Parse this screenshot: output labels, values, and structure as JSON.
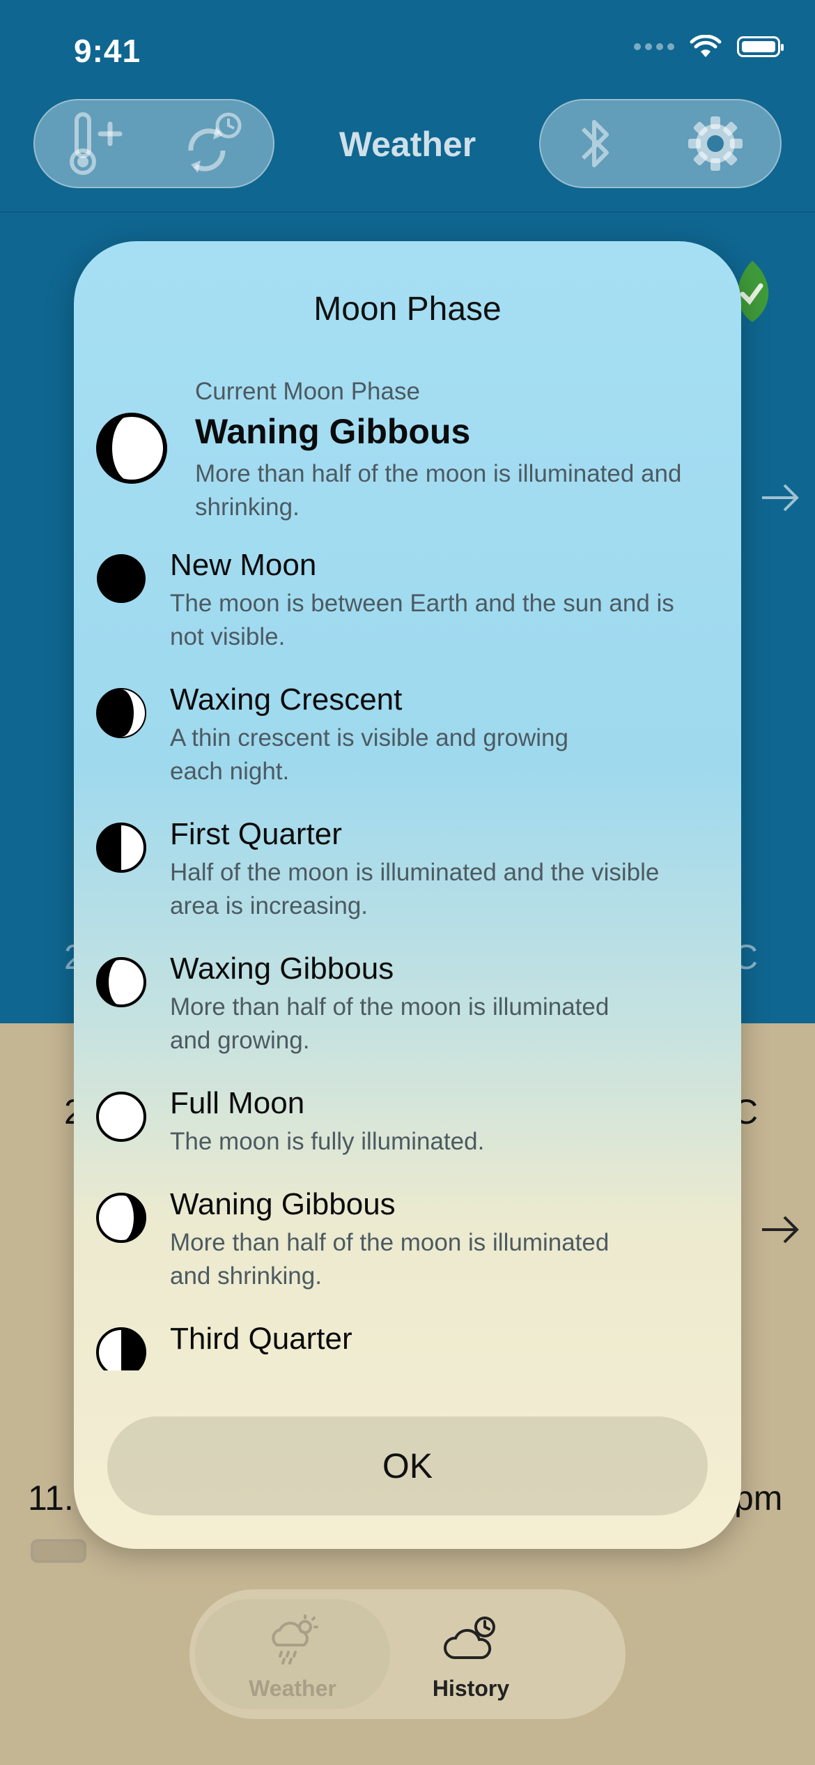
{
  "status_bar": {
    "time": "9:41"
  },
  "nav": {
    "title": "Weather"
  },
  "modal": {
    "title": "Moon Phase",
    "current": {
      "label": "Current Moon Phase",
      "name": "Waning Gibbous",
      "description": "More than half of the moon is illuminated and shrinking."
    },
    "phases": [
      {
        "name": "New Moon",
        "description": "The moon is between Earth and the sun and is not visible.",
        "icon": "new-moon-icon"
      },
      {
        "name": "Waxing Crescent",
        "description": "A thin crescent is visible and growing each night.",
        "icon": "waxing-crescent-icon"
      },
      {
        "name": "First Quarter",
        "description": "Half of the moon is illuminated and the visible area is increasing.",
        "icon": "first-quarter-icon"
      },
      {
        "name": "Waxing Gibbous",
        "description": "More than half of the moon is illuminated and growing.",
        "icon": "waxing-gibbous-icon"
      },
      {
        "name": "Full Moon",
        "description": "The moon is fully illuminated.",
        "icon": "full-moon-icon"
      },
      {
        "name": "Waning Gibbous",
        "description": "More than half of the moon is illuminated and shrinking.",
        "icon": "waning-gibbous-icon"
      },
      {
        "name": "Third Quarter",
        "description": "",
        "icon": "third-quarter-icon"
      }
    ],
    "ok_label": "OK"
  },
  "background": {
    "left_fragment_top": "2",
    "right_fragment_top": "C",
    "left_fragment_mid": "2",
    "right_fragment_mid": "C",
    "left_fragment_bottom": "11.",
    "right_fragment_bottom": "pm"
  },
  "tabbar": {
    "tabs": [
      {
        "label": "Weather",
        "selected": true
      },
      {
        "label": "History",
        "selected": false
      }
    ]
  },
  "colors": {
    "top_background": "#0f6690",
    "bottom_background": "#c4b593",
    "modal_top": "#a6dff4",
    "modal_bottom": "#f5eed3"
  }
}
